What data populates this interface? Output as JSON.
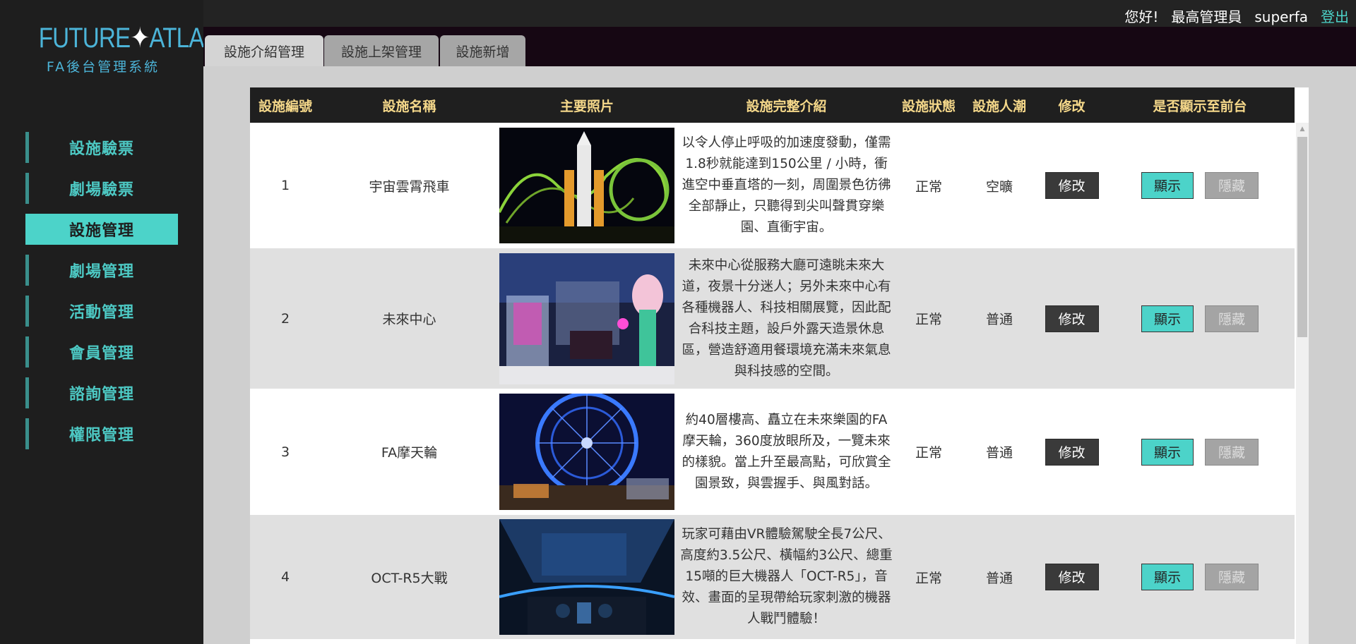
{
  "logo": {
    "left": "FUTURE",
    "star": "✦",
    "right": "ATLAS",
    "subtitle": "FA後台管理系統"
  },
  "topbar": {
    "greeting": "您好!",
    "role": "最高管理員",
    "username": "superfa",
    "logout": "登出"
  },
  "sidebar": {
    "items": [
      {
        "label": "設施驗票",
        "active": false
      },
      {
        "label": "劇場驗票",
        "active": false
      },
      {
        "label": "設施管理",
        "active": true
      },
      {
        "label": "劇場管理",
        "active": false
      },
      {
        "label": "活動管理",
        "active": false
      },
      {
        "label": "會員管理",
        "active": false
      },
      {
        "label": "諮詢管理",
        "active": false
      },
      {
        "label": "權限管理",
        "active": false
      }
    ]
  },
  "tabs": [
    {
      "label": "設施介紹管理",
      "active": true
    },
    {
      "label": "設施上架管理",
      "active": false
    },
    {
      "label": "設施新增",
      "active": false
    }
  ],
  "table": {
    "headers": [
      "設施編號",
      "設施名稱",
      "主要照片",
      "設施完整介紹",
      "設施狀態",
      "設施人潮",
      "修改",
      "是否顯示至前台"
    ],
    "rows": [
      {
        "id": "1",
        "name": "宇宙雲霄飛車",
        "description": "以令人停止呼吸的加速度發動，僅需1.8秒就能達到150公里 / 小時，衝進空中垂直塔的一刻，周圍景色彷彿全部靜止，只聽得到尖叫聲貫穿樂園、直衝宇宙。",
        "status": "正常",
        "crowd": "空曠",
        "edit": "修改",
        "show": "顯示",
        "hide": "隱藏",
        "photo": "roller-coaster"
      },
      {
        "id": "2",
        "name": "未來中心",
        "description": "未來中心從服務大廳可遠眺未來大道，夜景十分迷人；另外未來中心有各種機器人、科技相關展覽，因此配合科技主題，設戶外露天造景休息區，營造舒適用餐環境充滿未來氣息與科技感的空間。",
        "status": "正常",
        "crowd": "普通",
        "edit": "修改",
        "show": "顯示",
        "hide": "隱藏",
        "photo": "future-center"
      },
      {
        "id": "3",
        "name": "FA摩天輪",
        "description": "約40層樓高、矗立在未來樂園的FA摩天輪，360度放眼所及，一覽未來的樣貌。當上升至最高點，可欣賞全園景致，與雲握手、與風對話。",
        "status": "正常",
        "crowd": "普通",
        "edit": "修改",
        "show": "顯示",
        "hide": "隱藏",
        "photo": "ferris-wheel"
      },
      {
        "id": "4",
        "name": "OCT-R5大戰",
        "description": "玩家可藉由VR體驗駕駛全長7公尺、高度約3.5公尺、橫幅約3公尺、總重15噸的巨大機器人「OCT-R5」，音效、畫面的呈現帶給玩家刺激的機器人戰鬥體驗！",
        "status": "正常",
        "crowd": "普通",
        "edit": "修改",
        "show": "顯示",
        "hide": "隱藏",
        "photo": "vr-cockpit"
      }
    ]
  },
  "colors": {
    "accent": "#4cd3c9",
    "header_text": "#f5d88a",
    "logo": "#4cb4d8"
  }
}
